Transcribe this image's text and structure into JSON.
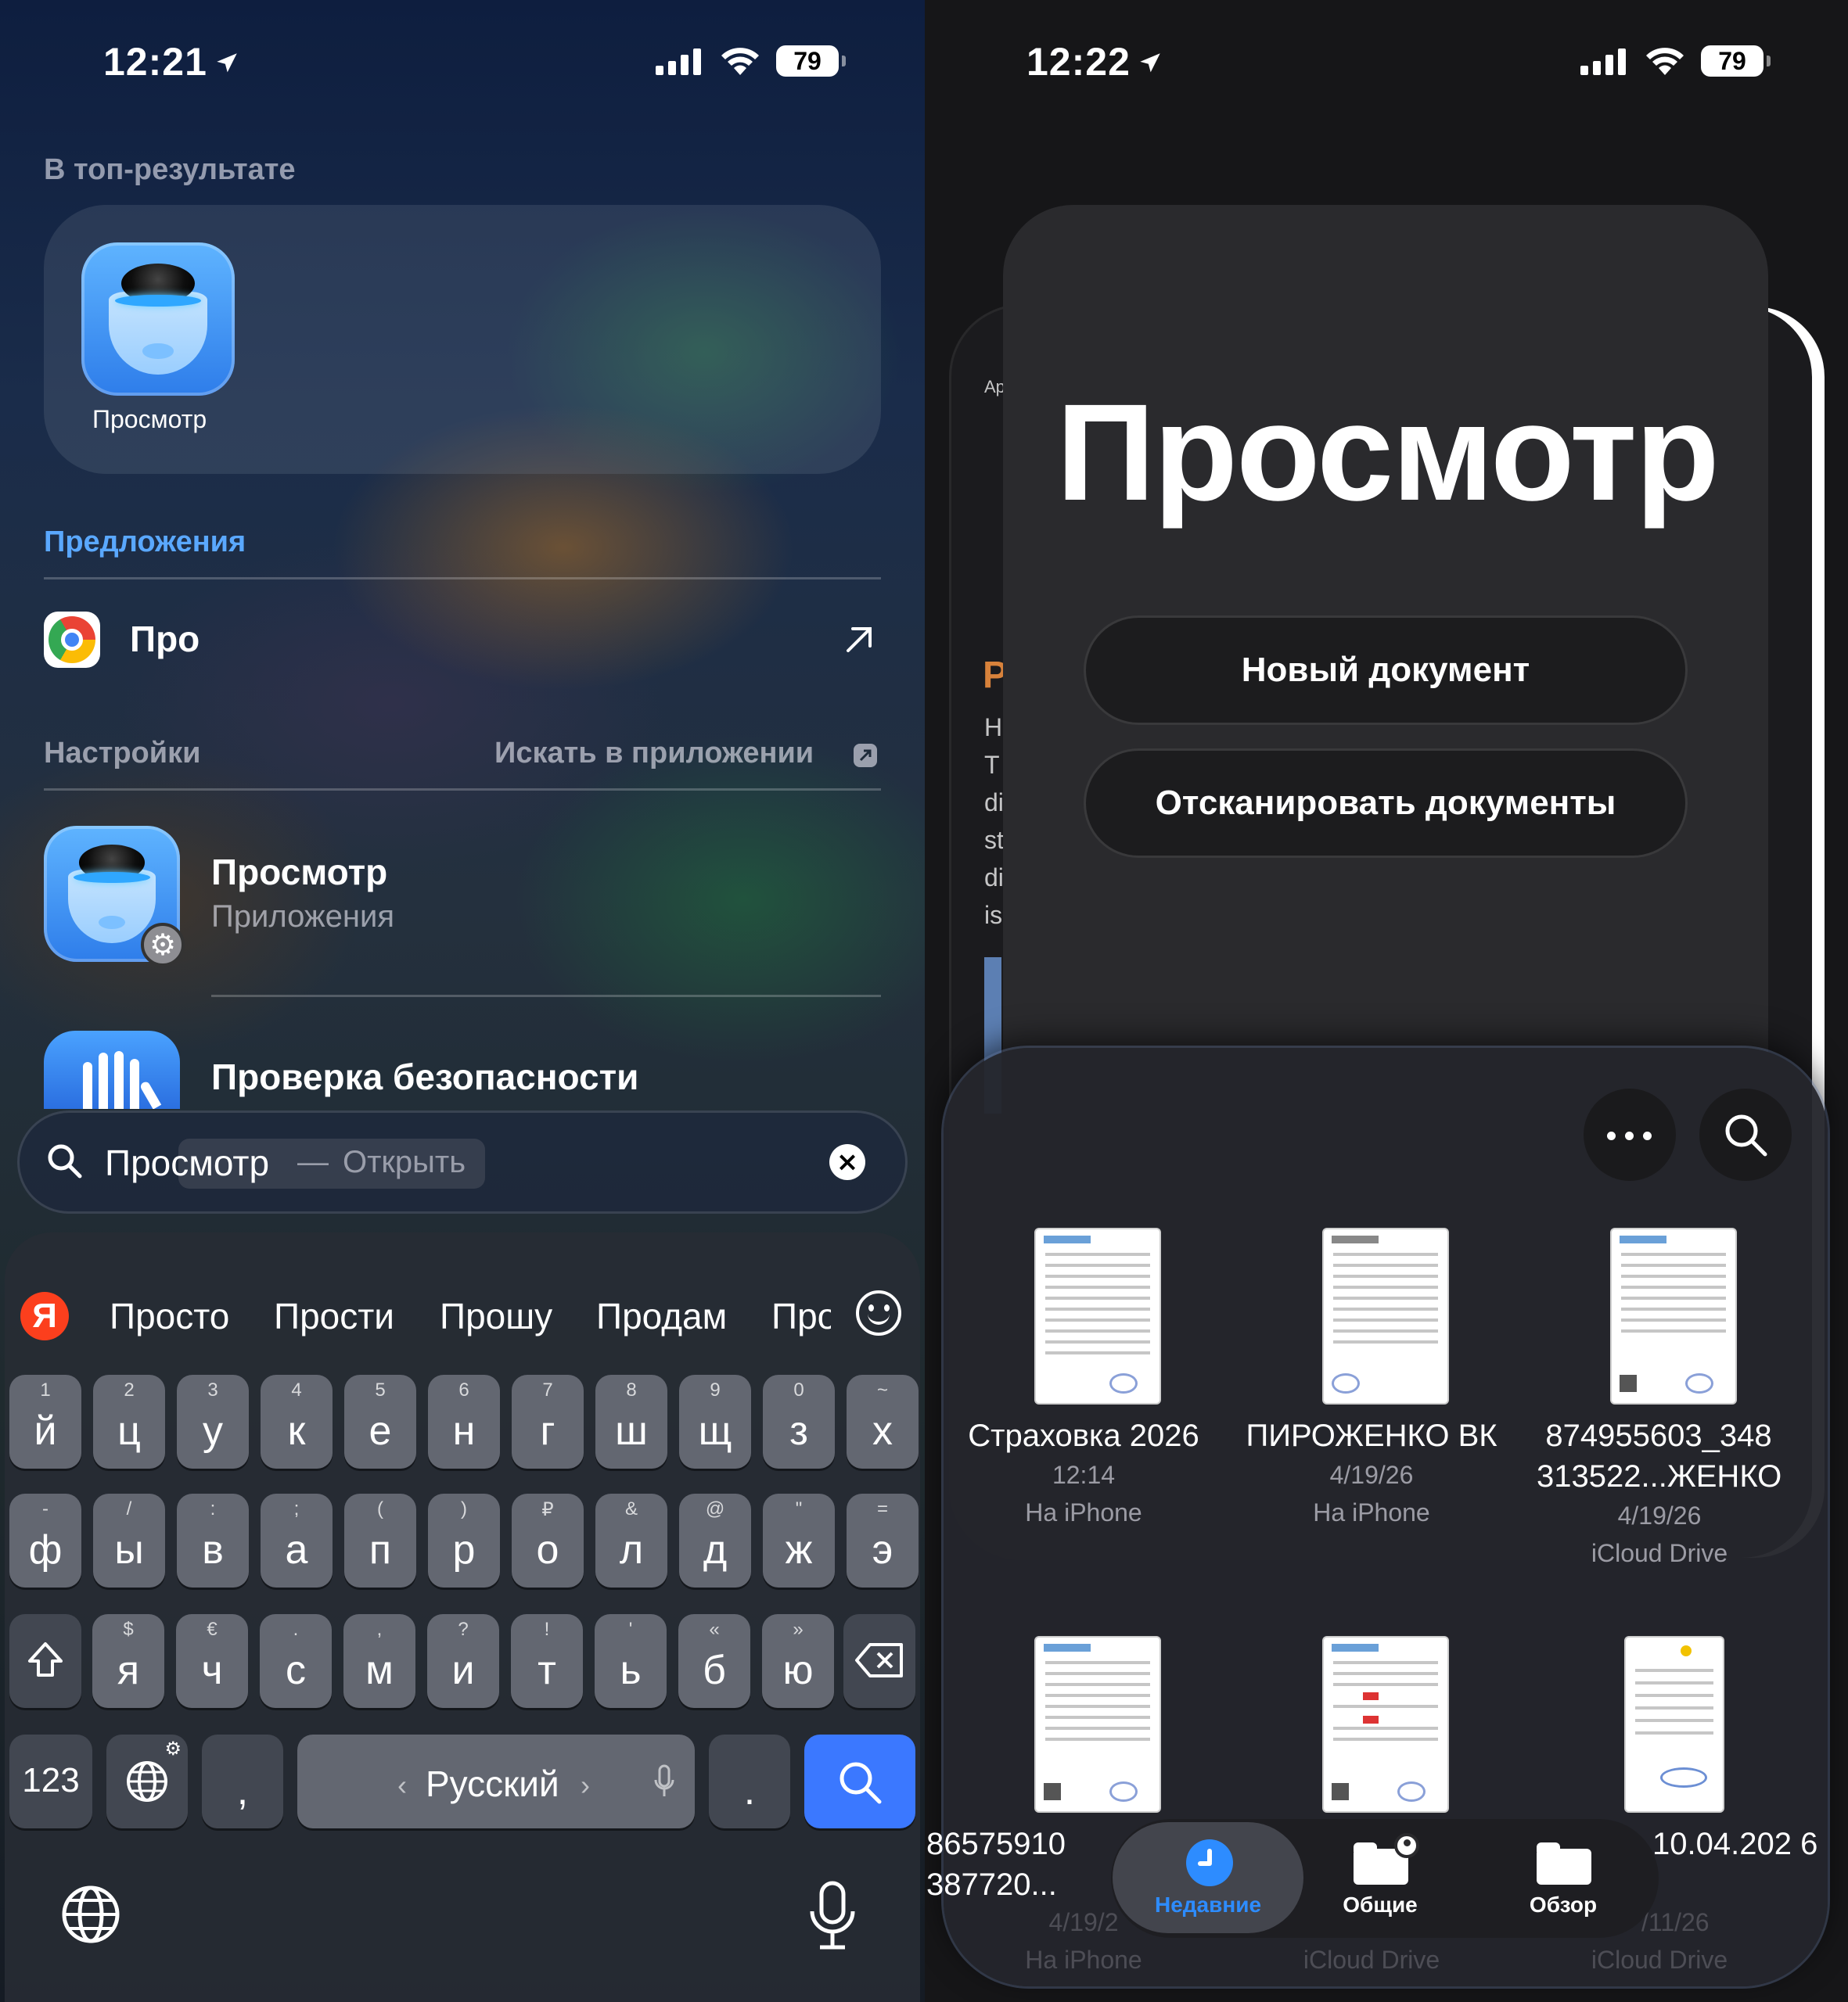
{
  "left": {
    "status": {
      "time": "12:21",
      "battery": "79"
    },
    "top_hit_header": "В топ-результате",
    "top_hit_app": "Просмотр",
    "suggestions_header": "Предложения",
    "suggestion": {
      "text": "Про"
    },
    "settings_header": "Настройки",
    "search_in_app": "Искать в приложении",
    "results": [
      {
        "title": "Просмотр",
        "subtitle": "Приложения"
      },
      {
        "title": "Проверка безопасности"
      }
    ],
    "search": {
      "query": "Просмотр",
      "dash": "—",
      "completion": "Открыть"
    },
    "keyboard": {
      "suggestions": [
        "Просто",
        "Прости",
        "Прошу",
        "Продам",
        "Про"
      ],
      "yandex_logo": "Я",
      "row1": [
        {
          "main": "й",
          "alt": "1"
        },
        {
          "main": "ц",
          "alt": "2"
        },
        {
          "main": "у",
          "alt": "3"
        },
        {
          "main": "к",
          "alt": "4"
        },
        {
          "main": "е",
          "alt": "5"
        },
        {
          "main": "н",
          "alt": "6"
        },
        {
          "main": "г",
          "alt": "7"
        },
        {
          "main": "ш",
          "alt": "8"
        },
        {
          "main": "щ",
          "alt": "9"
        },
        {
          "main": "з",
          "alt": "0"
        },
        {
          "main": "х",
          "alt": "~"
        }
      ],
      "row2": [
        {
          "main": "ф",
          "alt": "-"
        },
        {
          "main": "ы",
          "alt": "/"
        },
        {
          "main": "в",
          "alt": ":"
        },
        {
          "main": "а",
          "alt": ";"
        },
        {
          "main": "п",
          "alt": "("
        },
        {
          "main": "р",
          "alt": ")"
        },
        {
          "main": "о",
          "alt": "₽"
        },
        {
          "main": "л",
          "alt": "&"
        },
        {
          "main": "д",
          "alt": "@"
        },
        {
          "main": "ж",
          "alt": "\""
        },
        {
          "main": "э",
          "alt": "="
        }
      ],
      "row3": [
        {
          "main": "я",
          "alt": "$"
        },
        {
          "main": "ч",
          "alt": "€"
        },
        {
          "main": "с",
          "alt": "."
        },
        {
          "main": "м",
          "alt": ","
        },
        {
          "main": "и",
          "alt": "?"
        },
        {
          "main": "т",
          "alt": "!"
        },
        {
          "main": "ь",
          "alt": "'"
        },
        {
          "main": "б",
          "alt": "«"
        },
        {
          "main": "ю",
          "alt": "»"
        }
      ],
      "num_key": "123",
      "comma_key": ",",
      "space_label": "Русский",
      "space_left": "‹",
      "space_right": "›",
      "period_key": "."
    }
  },
  "right": {
    "status": {
      "time": "12:22",
      "battery": "79"
    },
    "app_title": "Просмотр",
    "new_document": "Новый документ",
    "scan_documents": "Отсканировать документы",
    "peek_lines": [
      "Ар",
      "Р",
      "Н",
      "Т",
      "di",
      "st",
      "di",
      "is"
    ],
    "files": [
      {
        "name": "Страховка 2026",
        "date": "12:14",
        "location": "На iPhone"
      },
      {
        "name": "ПИРОЖЕНКО ВК",
        "date": "4/19/26",
        "location": "На iPhone"
      },
      {
        "name": "874955603_348 313522...ЖЕНКО",
        "date": "4/19/26",
        "location": "iCloud Drive"
      },
      {
        "name": "86575910 387720...",
        "date": "4/19/2",
        "location": "На iPhone"
      },
      {
        "name": "",
        "date": "",
        "location": "iCloud Drive"
      },
      {
        "name": "10.04.202 6",
        "date": "/11/26",
        "location": "iCloud Drive"
      }
    ],
    "tabs": [
      "Недавние",
      "Общие",
      "Обзор"
    ],
    "colors": {
      "accent": "#2D8CFF",
      "search_key": "#3B78FF",
      "yandex": "#FC3F1D"
    }
  }
}
